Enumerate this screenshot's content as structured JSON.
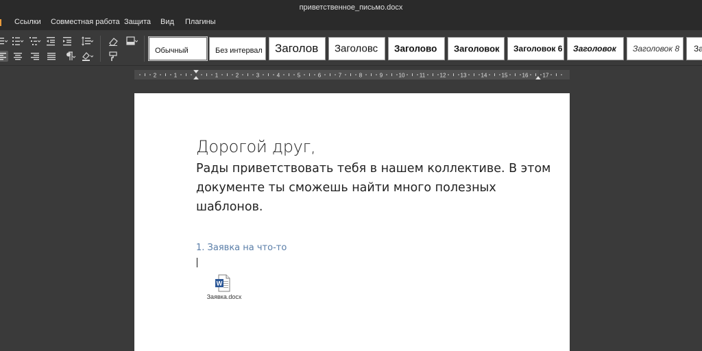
{
  "window": {
    "title": "приветственное_письмо.docx"
  },
  "menu": {
    "items": [
      "Ссылки",
      "Совместная работа",
      "Защита",
      "Вид",
      "Плагины"
    ]
  },
  "styles": {
    "items": [
      "Обычный",
      "Без интервал",
      "Заголов",
      "Заголовс",
      "Заголово",
      "Заголовок",
      "Заголовок 6",
      "Заголовок",
      "Заголовок 8",
      "За"
    ],
    "selected": "Обычный"
  },
  "ruler": {
    "labels": [
      "2",
      "1",
      "1",
      "2",
      "3",
      "4",
      "5",
      "6",
      "7",
      "8",
      "9",
      "10",
      "11",
      "12",
      "13",
      "14",
      "15",
      "16",
      "17"
    ]
  },
  "document": {
    "greeting": "Дорогой друг,",
    "paragraph": "Рады приветствовать тебя в нашем коллективе. В этом документе ты сможешь найти много полезных шаблонов.",
    "list_item": "1. Заявка на что-то",
    "attachment": {
      "name": "Заявка.docx",
      "icon": "word-file-icon"
    }
  },
  "colors": {
    "heading_blue": "#5a7ea8",
    "word_blue": "#2b5797",
    "accent": "#e89a3c"
  }
}
